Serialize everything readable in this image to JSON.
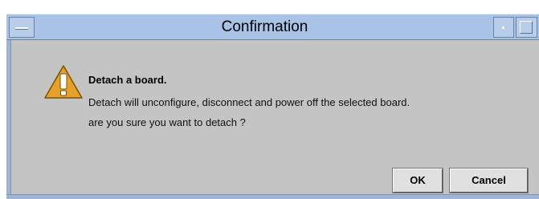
{
  "window": {
    "title": "Confirmation"
  },
  "icons": {
    "window_menu": "window-menu-icon",
    "minimize": "minimize-icon",
    "maximize": "maximize-icon",
    "warning": "warning-triangle-icon"
  },
  "message": {
    "heading": "Detach a board.",
    "line1": "Detach will unconfigure, disconnect and power off the selected board.",
    "line2": "are you sure you want to detach ?"
  },
  "buttons": {
    "ok_label": "OK",
    "cancel_label": "Cancel"
  },
  "colors": {
    "titlebar": "#a9c3e6",
    "dialog_bg": "#c4c4c4",
    "warning_fill": "#e6a12a"
  }
}
